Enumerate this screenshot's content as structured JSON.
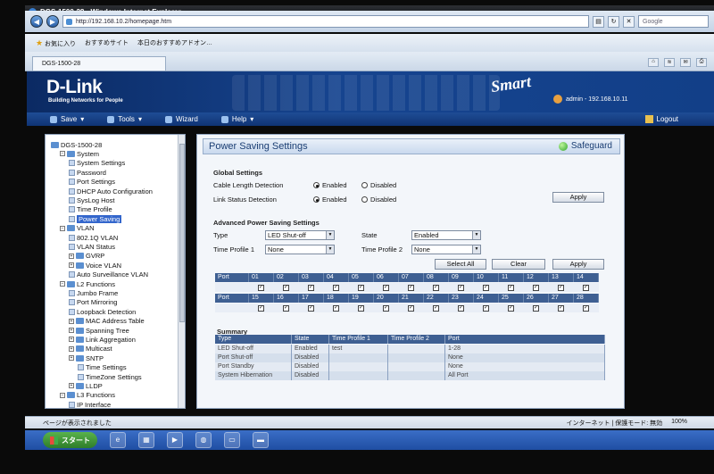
{
  "browser": {
    "title": "DGS-1500-28 - Windows Internet Explorer",
    "url": "http://192.168.10.2/homepage.htm",
    "search_placeholder": "Google",
    "favorites_label": "お気に入り",
    "fav_site1": "おすすめサイト",
    "fav_site2": "本日のおすすめアドオン…",
    "tab_label": "DGS-1500-28",
    "status_text": "ページが表示されました",
    "status_zone": "インターネット | 保護モード: 無効",
    "zoom": "100%"
  },
  "header": {
    "logo": "D-Link",
    "tagline": "Building Networks for People",
    "product": "Smart",
    "user": "admin - 192.168.10.11"
  },
  "menu": {
    "save": "Save",
    "tools": "Tools",
    "wizard": "Wizard",
    "help": "Help",
    "logout": "Logout"
  },
  "tree": [
    {
      "label": "DGS-1500-28",
      "level": 0,
      "kind": "device"
    },
    {
      "label": "System",
      "level": 1,
      "kind": "folder"
    },
    {
      "label": "System Settings",
      "level": 2,
      "kind": "page"
    },
    {
      "label": "Password",
      "level": 2,
      "kind": "page"
    },
    {
      "label": "Port Settings",
      "level": 2,
      "kind": "page"
    },
    {
      "label": "DHCP Auto Configuration",
      "level": 2,
      "kind": "page"
    },
    {
      "label": "SysLog Host",
      "level": 2,
      "kind": "page"
    },
    {
      "label": "Time Profile",
      "level": 2,
      "kind": "page"
    },
    {
      "label": "Power Saving",
      "level": 2,
      "kind": "page",
      "selected": true
    },
    {
      "label": "VLAN",
      "level": 1,
      "kind": "folder"
    },
    {
      "label": "802.1Q VLAN",
      "level": 2,
      "kind": "page"
    },
    {
      "label": "VLAN Status",
      "level": 2,
      "kind": "page"
    },
    {
      "label": "GVRP",
      "level": 2,
      "kind": "folder"
    },
    {
      "label": "Voice VLAN",
      "level": 2,
      "kind": "folder"
    },
    {
      "label": "Auto Surveillance VLAN",
      "level": 2,
      "kind": "page"
    },
    {
      "label": "L2 Functions",
      "level": 1,
      "kind": "folder"
    },
    {
      "label": "Jumbo Frame",
      "level": 2,
      "kind": "page"
    },
    {
      "label": "Port Mirroring",
      "level": 2,
      "kind": "page"
    },
    {
      "label": "Loopback Detection",
      "level": 2,
      "kind": "page"
    },
    {
      "label": "MAC Address Table",
      "level": 2,
      "kind": "folder"
    },
    {
      "label": "Spanning Tree",
      "level": 2,
      "kind": "folder"
    },
    {
      "label": "Link Aggregation",
      "level": 2,
      "kind": "folder"
    },
    {
      "label": "Multicast",
      "level": 2,
      "kind": "folder"
    },
    {
      "label": "SNTP",
      "level": 2,
      "kind": "folder"
    },
    {
      "label": "Time Settings",
      "level": 3,
      "kind": "page"
    },
    {
      "label": "TimeZone Settings",
      "level": 3,
      "kind": "page"
    },
    {
      "label": "LLDP",
      "level": 2,
      "kind": "folder"
    },
    {
      "label": "L3 Functions",
      "level": 1,
      "kind": "folder"
    },
    {
      "label": "IP Interface",
      "level": 2,
      "kind": "page"
    }
  ],
  "panel": {
    "title": "Power Saving Settings",
    "safeguard": "Safeguard",
    "global_heading": "Global Settings",
    "cable_label": "Cable Length Detection",
    "link_label": "Link Status Detection",
    "enabled": "Enabled",
    "disabled": "Disabled",
    "apply": "Apply",
    "advanced_heading": "Advanced Power Saving Settings",
    "type_label": "Type",
    "type_value": "LED Shut-off",
    "state_label": "State",
    "state_value": "Enabled",
    "tp1_label": "Time Profile 1",
    "tp1_value": "None",
    "tp2_label": "Time Profile 2",
    "tp2_value": "None",
    "select_all": "Select All",
    "clear": "Clear",
    "port_label": "Port",
    "ports_row1": [
      "01",
      "02",
      "03",
      "04",
      "05",
      "06",
      "07",
      "08",
      "09",
      "10",
      "11",
      "12",
      "13",
      "14"
    ],
    "ports_row2": [
      "15",
      "16",
      "17",
      "18",
      "19",
      "20",
      "21",
      "22",
      "23",
      "24",
      "25",
      "26",
      "27",
      "28"
    ],
    "summary_heading": "Summary",
    "summary_cols": [
      "Type",
      "State",
      "Time Profile 1",
      "Time Profile 2",
      "Port"
    ],
    "summary_rows": [
      [
        "LED Shut-off",
        "Enabled",
        "test",
        "",
        "1-28"
      ],
      [
        "Port Shut-off",
        "Disabled",
        "",
        "",
        "None"
      ],
      [
        "Port Standby",
        "Disabled",
        "",
        "",
        "None"
      ],
      [
        "System Hibernation",
        "Disabled",
        "",
        "",
        "All Port"
      ]
    ]
  },
  "taskbar": {
    "start": "スタート"
  }
}
